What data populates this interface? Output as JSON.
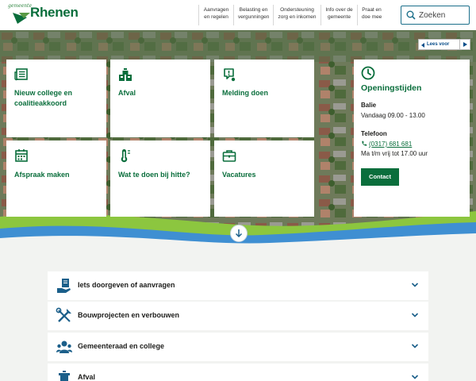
{
  "header": {
    "logo_small": "gemeente",
    "logo_big": "Rhenen",
    "nav": [
      {
        "line1": "Aanvragen",
        "line2": "en regelen"
      },
      {
        "line1": "Belasting en",
        "line2": "vergunningen"
      },
      {
        "line1": "Ondersteuning",
        "line2": "zorg en inkomen"
      },
      {
        "line1": "Info over de",
        "line2": "gemeente"
      },
      {
        "line1": "Praat en",
        "line2": "doe mee"
      }
    ],
    "search_placeholder": "Zoeken"
  },
  "readspeaker": {
    "label": "Lees voor"
  },
  "tiles": [
    {
      "label": "Nieuw college en coalitieakkoord",
      "icon": "newspaper-icon"
    },
    {
      "label": "Afval",
      "icon": "waste-bins-icon"
    },
    {
      "label": "Melding doen",
      "icon": "report-pin-icon"
    },
    {
      "label": "Afspraak maken",
      "icon": "calendar-icon"
    },
    {
      "label": "Wat te doen bij hitte?",
      "icon": "thermometer-icon"
    },
    {
      "label": "Vacatures",
      "icon": "briefcase-icon"
    }
  ],
  "hours": {
    "title": "Openingstijden",
    "desk_label": "Balie",
    "desk_text": "Vandaag 09.00 - 13.00",
    "phone_label": "Telefoon",
    "phone_number": "(0317) 681 681",
    "phone_text": "Ma t/m vrij tot 17.00 uur",
    "button": "Contact"
  },
  "accordion": [
    {
      "label": "Iets doorgeven of aanvragen",
      "icon": "hand-document-icon"
    },
    {
      "label": "Bouwprojecten en verbouwen",
      "icon": "tools-icon"
    },
    {
      "label": "Gemeenteraad en college",
      "icon": "people-icon"
    },
    {
      "label": "Afval",
      "icon": "waste-bin-icon"
    }
  ],
  "colors": {
    "brand_green": "#0a6e3c",
    "wave_light_green": "#8cc63f",
    "wave_blue": "#3f8fd2",
    "search_border": "#1b6f8a"
  }
}
